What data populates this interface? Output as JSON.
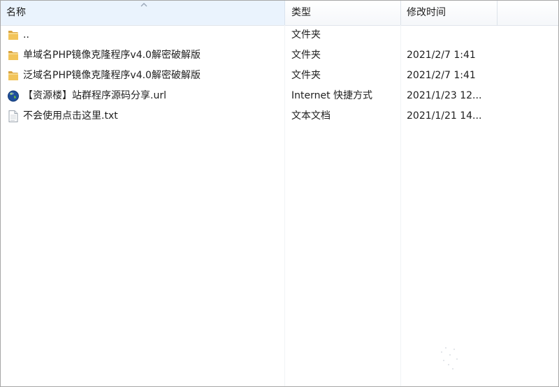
{
  "columns": {
    "name": "名称",
    "type": "类型",
    "date": "修改时间"
  },
  "files": [
    {
      "icon": "folder-icon",
      "name": "..",
      "type": "文件夹",
      "date": ""
    },
    {
      "icon": "folder-icon",
      "name": "单域名PHP镜像克隆程序v4.0解密破解版",
      "type": "文件夹",
      "date": "2021/2/7 1:41"
    },
    {
      "icon": "folder-icon",
      "name": "泛域名PHP镜像克隆程序v4.0解密破解版",
      "type": "文件夹",
      "date": "2021/2/7 1:41"
    },
    {
      "icon": "globe-icon",
      "name": "【资源楼】站群程序源码分享.url",
      "type": "Internet 快捷方式",
      "date": "2021/1/23 12..."
    },
    {
      "icon": "text-file-icon",
      "name": "不会使用点击这里.txt",
      "type": "文本文档",
      "date": "2021/1/21 14..."
    }
  ]
}
